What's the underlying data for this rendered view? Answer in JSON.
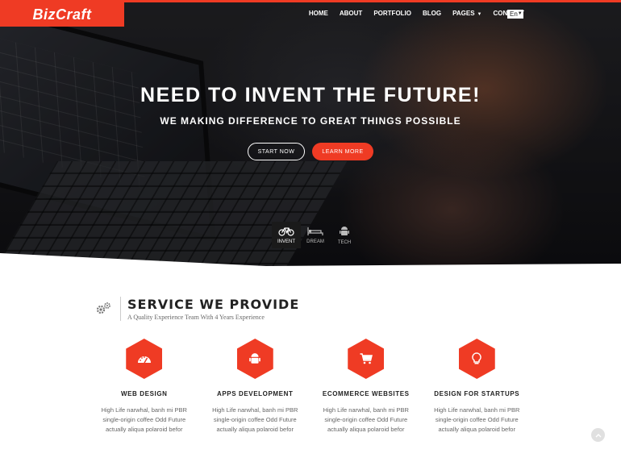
{
  "brand": {
    "logo_text": "BizCraft",
    "accent": "#ef3b24"
  },
  "nav": {
    "items": [
      "HOME",
      "ABOUT",
      "PORTFOLIO",
      "BLOG",
      "PAGES",
      "CONTACT"
    ],
    "language": "En"
  },
  "hero": {
    "title": "NEED TO INVENT THE FUTURE!",
    "subtitle": "WE MAKING DIFFERENCE TO GREAT THINGS POSSIBLE",
    "start_label": "START NOW",
    "learn_label": "LEARN MORE",
    "slides": [
      {
        "label": "INVENT",
        "icon": "bicycle-icon",
        "active": true
      },
      {
        "label": "DREAM",
        "icon": "bed-icon",
        "active": false
      },
      {
        "label": "TECH",
        "icon": "android-icon",
        "active": false
      }
    ]
  },
  "services": {
    "title": "SERVICE WE PROVIDE",
    "subtitle": "A Quality Experience Team With 4 Years Experience",
    "items": [
      {
        "title": "WEB DESIGN",
        "icon": "dashboard-icon",
        "desc": "High Life narwhal, banh mi PBR single-origin coffee Odd Future actually aliqua polaroid befor"
      },
      {
        "title": "APPS DEVELOPMENT",
        "icon": "android-icon",
        "desc": "High Life narwhal, banh mi PBR single-origin coffee Odd Future actually aliqua polaroid befor"
      },
      {
        "title": "ECOMMERCE WEBSITES",
        "icon": "cart-icon",
        "desc": "High Life narwhal, banh mi PBR single-origin coffee Odd Future actually aliqua polaroid befor"
      },
      {
        "title": "DESIGN FOR STARTUPS",
        "icon": "lightbulb-icon",
        "desc": "High Life narwhal, banh mi PBR single-origin coffee Odd Future actually aliqua polaroid befor"
      }
    ]
  }
}
